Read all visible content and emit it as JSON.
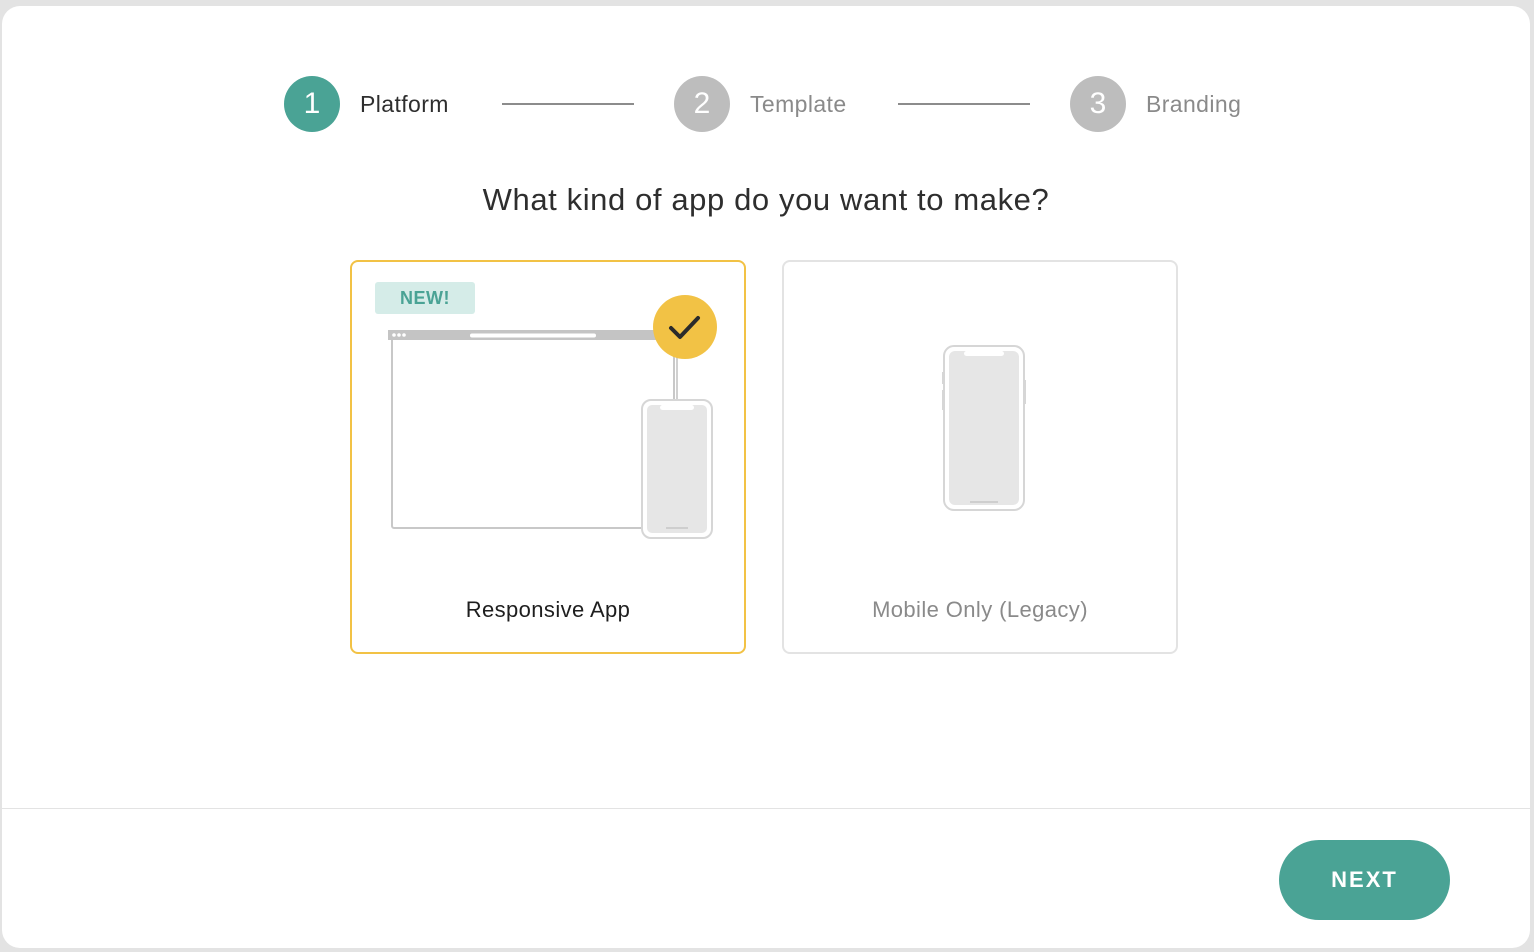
{
  "colors": {
    "accent": "#4aa395",
    "inactive_step": "#bdbdbd",
    "selected_border": "#f2c245",
    "check_badge": "#f2c245",
    "badge_bg": "#d5ece8"
  },
  "stepper": {
    "steps": [
      {
        "number": "1",
        "label": "Platform",
        "state": "active"
      },
      {
        "number": "2",
        "label": "Template",
        "state": "inactive"
      },
      {
        "number": "3",
        "label": "Branding",
        "state": "inactive"
      }
    ]
  },
  "main": {
    "question": "What kind of app do you want to make?"
  },
  "options": [
    {
      "title": "Responsive App",
      "badge": "NEW!",
      "selected": true,
      "icon": "browser-and-phone-illustration"
    },
    {
      "title": "Mobile Only (Legacy)",
      "selected": false,
      "icon": "phone-illustration"
    }
  ],
  "footer": {
    "next_label": "NEXT"
  }
}
